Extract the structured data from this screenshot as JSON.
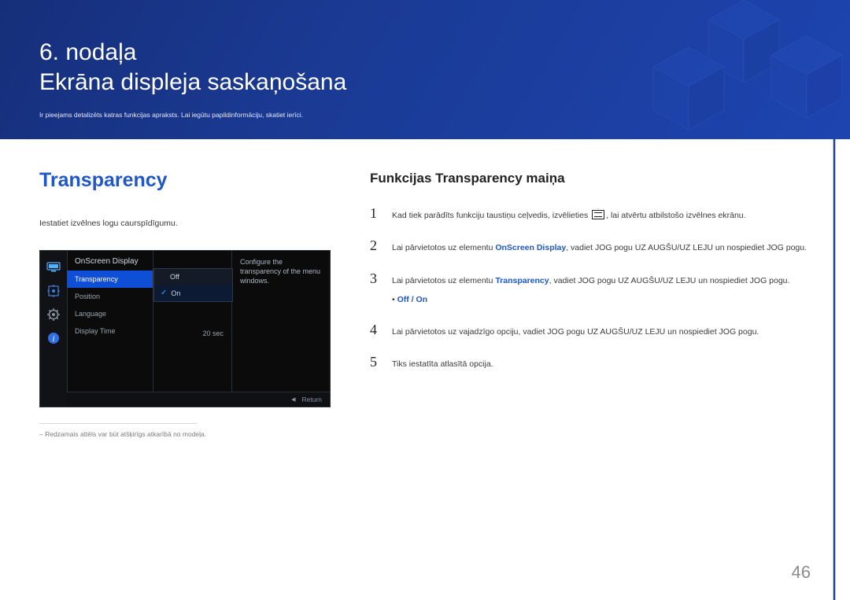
{
  "hero": {
    "chapter": "6. nodaļa",
    "title": "Ekrāna displeja saskaņošana",
    "sub": "Ir pieejams detalizēts katras funkcijas apraksts. Lai iegūtu papildinformāciju, skatiet ierīci."
  },
  "left": {
    "h2": "Transparency",
    "desc": "Iestatiet izvēlnes logu caurspīdīgumu.",
    "noteCaption": "Redzamais attēls var būt atšķirīgs atkarībā no modeļa."
  },
  "osd": {
    "panelTitle": "OnScreen Display",
    "rows": {
      "transparency": "Transparency",
      "position": "Position",
      "language": "Language",
      "displayTime": "Display Time"
    },
    "values": {
      "off": "Off",
      "displayTime": "20 sec"
    },
    "submenu": {
      "off": "Off",
      "on": "On"
    },
    "help": "Configure the transparency of the menu windows.",
    "footer": "Return",
    "icons": {
      "monitor": "monitor-icon",
      "grid": "grid-icon",
      "gear": "gear-icon",
      "info": "info-icon"
    }
  },
  "right": {
    "h2": "Funkcijas Transparency maiņa",
    "step1_a": "Kad tiek parādīts funkciju taustiņu ceļvedis, izvēlieties ",
    "step1_b": ", lai atvērtu atbilstošo izvēlnes ekrānu.",
    "step2_a": "Lai pārvietotos uz elementu ",
    "step2_bold": "OnScreen Display",
    "step2_b": ", vadiet JOG pogu UZ AUGŠU/UZ LEJU un nospiediet JOG pogu.",
    "step3_a": "Lai pārvietotos uz elementu ",
    "step3_bold": "Transparency",
    "step3_b": ", vadiet JOG pogu UZ AUGŠU/UZ LEJU un nospiediet JOG pogu.",
    "offOn": "Off / On",
    "step4": "Lai pārvietotos uz vajadzīgo opciju, vadiet JOG pogu UZ AUGŠU/UZ LEJU un nospiediet JOG pogu.",
    "step5": "Tiks iestatīta atlasītā opcija."
  },
  "pageNumber": "46"
}
